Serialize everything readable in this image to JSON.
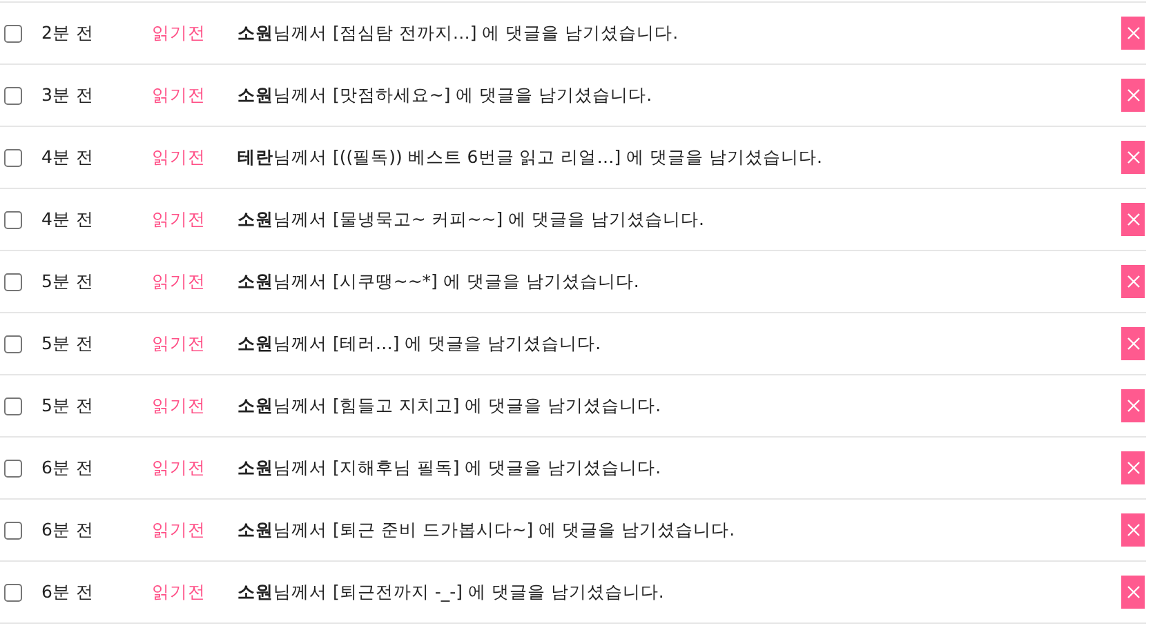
{
  "notifications": [
    {
      "checked": false,
      "time": "2분 전",
      "status": "읽기전",
      "message": "**소원**님께서 [점심탐 전까지…] 에 댓글을 남기셨습니다."
    },
    {
      "checked": false,
      "time": "3분 전",
      "status": "읽기전",
      "message": "**소원**님께서 [맛점하세요~] 에 댓글을 남기셨습니다."
    },
    {
      "checked": false,
      "time": "4분 전",
      "status": "읽기전",
      "message": "**테란**님께서 [((필독)) 베스트 6번글 읽고 리얼…] 에 댓글을 남기셨습니다."
    },
    {
      "checked": false,
      "time": "4분 전",
      "status": "읽기전",
      "message": "**소원**님께서 [물냉묵고~ 커피~~] 에 댓글을 남기셨습니다."
    },
    {
      "checked": false,
      "time": "5분 전",
      "status": "읽기전",
      "message": "**소원**님께서 [시쿠땡~~*] 에 댓글을 남기셨습니다."
    },
    {
      "checked": false,
      "time": "5분 전",
      "status": "읽기전",
      "message": "**소원**님께서 [테러…] 에 댓글을 남기셨습니다."
    },
    {
      "checked": false,
      "time": "5분 전",
      "status": "읽기전",
      "message": "**소원**님께서 [힘들고 지치고] 에 댓글을 남기셨습니다."
    },
    {
      "checked": false,
      "time": "6분 전",
      "status": "읽기전",
      "message": "**소원**님께서 [지해후님 필독] 에 댓글을 남기셨습니다."
    },
    {
      "checked": false,
      "time": "6분 전",
      "status": "읽기전",
      "message": "**소원**님께서 [퇴근 준비 드가봅시다~] 에 댓글을 남기셨습니다."
    },
    {
      "checked": false,
      "time": "6분 전",
      "status": "읽기전",
      "message": "**소원**님께서 [퇴근전까지 -_-] 에 댓글을 남기셨습니다."
    }
  ]
}
